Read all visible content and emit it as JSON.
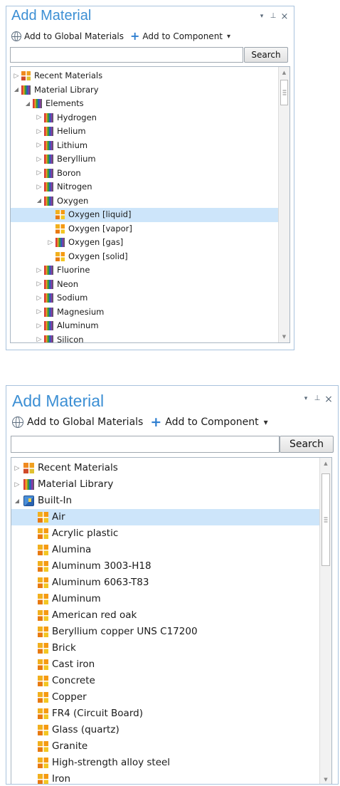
{
  "panel1": {
    "title": "Add Material",
    "window_buttons": {
      "menu": "▾",
      "pin": "⊥",
      "close": "×"
    },
    "toolbar": {
      "global_label": "Add to Global Materials",
      "component_label": "Add to Component",
      "dropdown": "▾"
    },
    "search": {
      "value": "",
      "button_label": "Search"
    },
    "tree": [
      {
        "label": "Recent Materials",
        "level": 0,
        "twisty": "▷",
        "icon": "recent-materials-icon"
      },
      {
        "label": "Material Library",
        "level": 0,
        "twisty": "◢",
        "icon": "library-icon"
      },
      {
        "label": "Elements",
        "level": 1,
        "twisty": "◢",
        "icon": "library-icon"
      },
      {
        "label": "Hydrogen",
        "level": 2,
        "twisty": "▷",
        "icon": "library-icon"
      },
      {
        "label": "Helium",
        "level": 2,
        "twisty": "▷",
        "icon": "library-icon"
      },
      {
        "label": "Lithium",
        "level": 2,
        "twisty": "▷",
        "icon": "library-icon"
      },
      {
        "label": "Beryllium",
        "level": 2,
        "twisty": "▷",
        "icon": "library-icon"
      },
      {
        "label": "Boron",
        "level": 2,
        "twisty": "▷",
        "icon": "library-icon"
      },
      {
        "label": "Nitrogen",
        "level": 2,
        "twisty": "▷",
        "icon": "library-icon"
      },
      {
        "label": "Oxygen",
        "level": 2,
        "twisty": "◢",
        "icon": "library-icon"
      },
      {
        "label": "Oxygen [liquid]",
        "level": 3,
        "twisty": "",
        "icon": "material-icon",
        "selected": true
      },
      {
        "label": "Oxygen [vapor]",
        "level": 3,
        "twisty": "",
        "icon": "material-icon"
      },
      {
        "label": "Oxygen [gas]",
        "level": 3,
        "twisty": "▷",
        "icon": "library-icon"
      },
      {
        "label": "Oxygen [solid]",
        "level": 3,
        "twisty": "",
        "icon": "material-icon"
      },
      {
        "label": "Fluorine",
        "level": 2,
        "twisty": "▷",
        "icon": "library-icon"
      },
      {
        "label": "Neon",
        "level": 2,
        "twisty": "▷",
        "icon": "library-icon"
      },
      {
        "label": "Sodium",
        "level": 2,
        "twisty": "▷",
        "icon": "library-icon"
      },
      {
        "label": "Magnesium",
        "level": 2,
        "twisty": "▷",
        "icon": "library-icon"
      },
      {
        "label": "Aluminum",
        "level": 2,
        "twisty": "▷",
        "icon": "library-icon"
      },
      {
        "label": "Silicon",
        "level": 2,
        "twisty": "▷",
        "icon": "library-icon"
      }
    ]
  },
  "panel2": {
    "title": "Add Material",
    "window_buttons": {
      "menu": "▾",
      "pin": "⊥",
      "close": "×"
    },
    "toolbar": {
      "global_label": "Add to Global Materials",
      "component_label": "Add to Component",
      "dropdown": "▾"
    },
    "search": {
      "value": "",
      "button_label": "Search"
    },
    "tree": [
      {
        "label": "Recent Materials",
        "level": 0,
        "twisty": "▷",
        "icon": "recent-materials-icon"
      },
      {
        "label": "Material Library",
        "level": 0,
        "twisty": "▷",
        "icon": "library-icon"
      },
      {
        "label": "Built-In",
        "level": 0,
        "twisty": "◢",
        "icon": "built-in-icon"
      },
      {
        "label": "Air",
        "level": 1,
        "twisty": "",
        "icon": "material-icon",
        "selected": true
      },
      {
        "label": "Acrylic plastic",
        "level": 1,
        "twisty": "",
        "icon": "material-icon"
      },
      {
        "label": "Alumina",
        "level": 1,
        "twisty": "",
        "icon": "material-icon"
      },
      {
        "label": "Aluminum 3003-H18",
        "level": 1,
        "twisty": "",
        "icon": "material-icon"
      },
      {
        "label": "Aluminum 6063-T83",
        "level": 1,
        "twisty": "",
        "icon": "material-icon"
      },
      {
        "label": "Aluminum",
        "level": 1,
        "twisty": "",
        "icon": "material-icon"
      },
      {
        "label": "American red oak",
        "level": 1,
        "twisty": "",
        "icon": "material-icon"
      },
      {
        "label": "Beryllium copper UNS C17200",
        "level": 1,
        "twisty": "",
        "icon": "material-icon"
      },
      {
        "label": "Brick",
        "level": 1,
        "twisty": "",
        "icon": "material-icon"
      },
      {
        "label": "Cast iron",
        "level": 1,
        "twisty": "",
        "icon": "material-icon"
      },
      {
        "label": "Concrete",
        "level": 1,
        "twisty": "",
        "icon": "material-icon"
      },
      {
        "label": "Copper",
        "level": 1,
        "twisty": "",
        "icon": "material-icon"
      },
      {
        "label": "FR4 (Circuit Board)",
        "level": 1,
        "twisty": "",
        "icon": "material-icon"
      },
      {
        "label": "Glass (quartz)",
        "level": 1,
        "twisty": "",
        "icon": "material-icon"
      },
      {
        "label": "Granite",
        "level": 1,
        "twisty": "",
        "icon": "material-icon"
      },
      {
        "label": "High-strength alloy steel",
        "level": 1,
        "twisty": "",
        "icon": "material-icon"
      },
      {
        "label": "Iron",
        "level": 1,
        "twisty": "",
        "icon": "material-icon"
      }
    ]
  }
}
